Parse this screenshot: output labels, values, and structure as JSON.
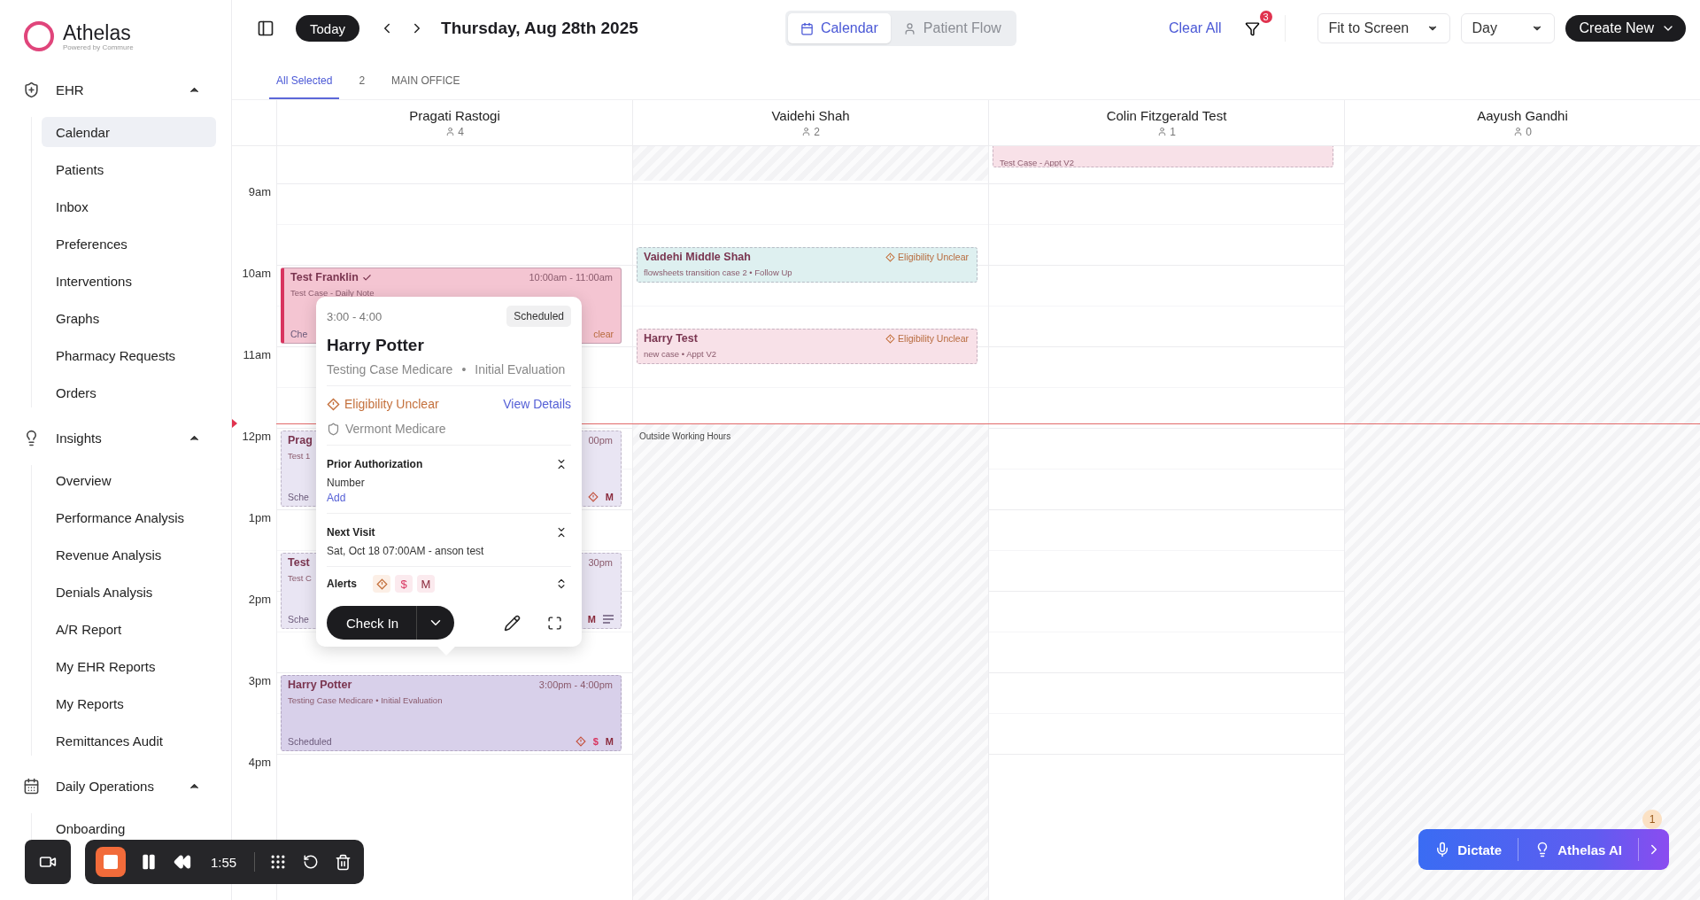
{
  "sidebar": {
    "logo": {
      "name": "Athelas",
      "tagline": "Powered by Commure"
    },
    "sections": [
      {
        "label": "EHR",
        "expanded": true,
        "items": [
          {
            "label": "Calendar",
            "selected": true
          },
          {
            "label": "Patients",
            "selected": false
          },
          {
            "label": "Inbox",
            "selected": false
          },
          {
            "label": "Preferences",
            "selected": false
          },
          {
            "label": "Interventions",
            "selected": false
          },
          {
            "label": "Graphs",
            "selected": false
          },
          {
            "label": "Pharmacy Requests",
            "selected": false
          },
          {
            "label": "Orders",
            "selected": false
          }
        ]
      },
      {
        "label": "Insights",
        "expanded": true,
        "items": [
          {
            "label": "Overview",
            "selected": false
          },
          {
            "label": "Performance Analysis",
            "selected": false
          },
          {
            "label": "Revenue Analysis",
            "selected": false
          },
          {
            "label": "Denials Analysis",
            "selected": false
          },
          {
            "label": "A/R Report",
            "selected": false
          },
          {
            "label": "My EHR Reports",
            "selected": false
          },
          {
            "label": "My Reports",
            "selected": false
          },
          {
            "label": "Remittances Audit",
            "selected": false
          }
        ]
      },
      {
        "label": "Daily Operations",
        "expanded": true,
        "items": [
          {
            "label": "Onboarding",
            "selected": false
          }
        ]
      }
    ]
  },
  "header": {
    "today": "Today",
    "date": "Thursday, Aug 28th 2025",
    "views": [
      {
        "label": "Calendar",
        "selected": true
      },
      {
        "label": "Patient Flow",
        "selected": false
      }
    ],
    "clear": "Clear All",
    "filter_count": "3",
    "zoom": "Fit to Screen",
    "range": "Day",
    "create": "Create New"
  },
  "filter_tabs": [
    {
      "label": "All Selected",
      "selected": true
    },
    {
      "label": "2",
      "selected": false
    },
    {
      "label": "MAIN OFFICE",
      "selected": false
    }
  ],
  "time_labels": [
    "9am",
    "10am",
    "11am",
    "12pm",
    "1pm",
    "2pm",
    "3pm",
    "4pm"
  ],
  "providers": [
    {
      "name": "Pragati Rastogi",
      "count": "4",
      "availability": {
        "kind": "all_day"
      },
      "events": [
        {
          "title": "Test Franklin",
          "confirmed": true,
          "time": "10:00am - 11:00am",
          "subtitle": "Test Case - Daily Note",
          "status": "Che",
          "trail": "clear",
          "color": "#f4c5d2"
        },
        {
          "title": "Prag",
          "confirmed": false,
          "time": "00pm",
          "subtitle": "Test 1",
          "status": "Sche",
          "alerts": [
            {
              "kind": "eligibility"
            },
            {
              "kind": "text",
              "text": "M"
            }
          ],
          "color": "#e9e5f3"
        },
        {
          "title": "Test",
          "confirmed": false,
          "time": "30pm",
          "subtitle": "Test C",
          "status": "Sche",
          "alerts": [
            {
              "kind": "text",
              "text": "M"
            },
            {
              "kind": "notes"
            }
          ],
          "color": "#e9e5f3"
        },
        {
          "title": "Harry Potter",
          "confirmed": false,
          "time": "3:00pm - 4:00pm",
          "subtitle": "Testing Case Medicare • Initial Evaluation",
          "status": "Scheduled",
          "alerts": [
            {
              "kind": "eligibility"
            },
            {
              "kind": "text",
              "text": "$"
            },
            {
              "kind": "text",
              "text": "M"
            }
          ],
          "color": "#d8d0ea"
        }
      ]
    },
    {
      "name": "Vaidehi Shah",
      "count": "2",
      "availability": {
        "kind": "window",
        "label": "Outside Working Hours"
      },
      "events": [
        {
          "title": "Vaidehi Middle Shah",
          "confirmed": false,
          "tag": "Eligibility Unclear",
          "subtitle": "flowsheets transition case 2 • Follow Up",
          "color": "#def0f0"
        },
        {
          "title": "Harry Test",
          "confirmed": false,
          "tag": "Eligibility Unclear",
          "subtitle": "new case • Appt V2",
          "color": "#f8e1e8"
        }
      ]
    },
    {
      "name": "Colin Fitzgerald Test",
      "count": "1",
      "availability": {
        "kind": "all_day"
      },
      "events": [
        {
          "confirmed": false,
          "subtitle": "Test Case - Appt V2",
          "color": "#f8e1e8"
        }
      ]
    },
    {
      "name": "Aayush Gandhi",
      "count": "0",
      "availability": {
        "kind": "none"
      }
    }
  ],
  "popover": {
    "time": "3:00 - 4:00",
    "status": "Scheduled",
    "patient": "Harry Potter",
    "case": "Testing Case Medicare",
    "separator": "•",
    "visit_type": "Initial Evaluation",
    "eligibility": "Eligibility Unclear",
    "view_details": "View Details",
    "insurance": "Vermont Medicare",
    "sections": [
      {
        "kind": "auth",
        "title": "Prior Authorization",
        "expanded": true,
        "label": "Number",
        "action": "Add"
      },
      {
        "kind": "visit",
        "title": "Next Visit",
        "expanded": true,
        "value": "Sat, Oct 18 07:00AM - anson test"
      },
      {
        "kind": "alerts",
        "title": "Alerts",
        "expanded": false,
        "alerts": [
          {
            "kind": "eligibility"
          },
          {
            "kind": "text",
            "text": "$"
          },
          {
            "kind": "text",
            "text": "M"
          }
        ]
      }
    ],
    "primary": "Check In"
  },
  "recorder": {
    "elapsed": "1:55"
  },
  "assistant": {
    "dictate": "Dictate",
    "ai": "Athelas AI",
    "badge": "1"
  }
}
